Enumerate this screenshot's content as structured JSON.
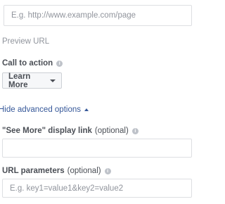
{
  "destination": {
    "url_placeholder": "E.g. http://www.example.com/page",
    "preview_label": "Preview URL"
  },
  "call_to_action": {
    "label": "Call to action",
    "info_icon": "info-icon",
    "selected": "Learn More"
  },
  "advanced": {
    "toggle_label": "Hide advanced options"
  },
  "see_more": {
    "label": "\"See More\" display link",
    "optional": "(optional)",
    "value": ""
  },
  "url_params": {
    "label": "URL parameters",
    "optional": "(optional)",
    "placeholder": "E.g. key1=value1&key2=value2"
  }
}
